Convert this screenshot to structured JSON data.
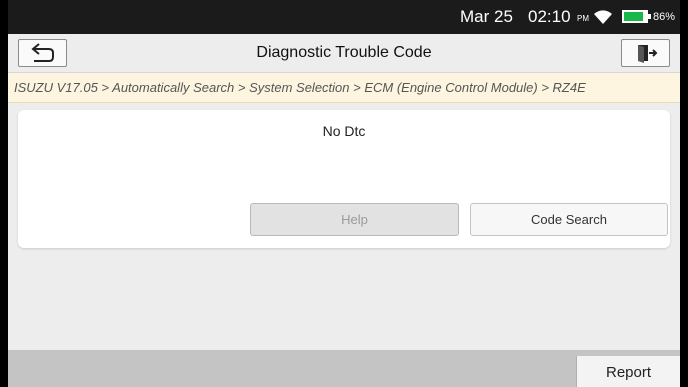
{
  "status_bar": {
    "date": "Mar 25",
    "time": "02:10",
    "ampm": "PM",
    "battery_percent": "86%",
    "battery_level": 0.86
  },
  "title_bar": {
    "title": "Diagnostic Trouble Code",
    "back_icon": "return-arrow-icon",
    "exit_icon": "exit-door-icon"
  },
  "breadcrumb": "ISUZU V17.05 > Automatically Search > System Selection > ECM (Engine Control Module) > RZ4E",
  "result": {
    "message": "No Dtc",
    "help_label": "Help",
    "code_search_label": "Code Search"
  },
  "footer": {
    "report_label": "Report"
  },
  "colors": {
    "status_bar_bg": "#1b1b1b",
    "breadcrumb_bg": "#fdf5e0",
    "battery_fill": "#19b84a",
    "footer_bg": "#c4c4c4"
  }
}
